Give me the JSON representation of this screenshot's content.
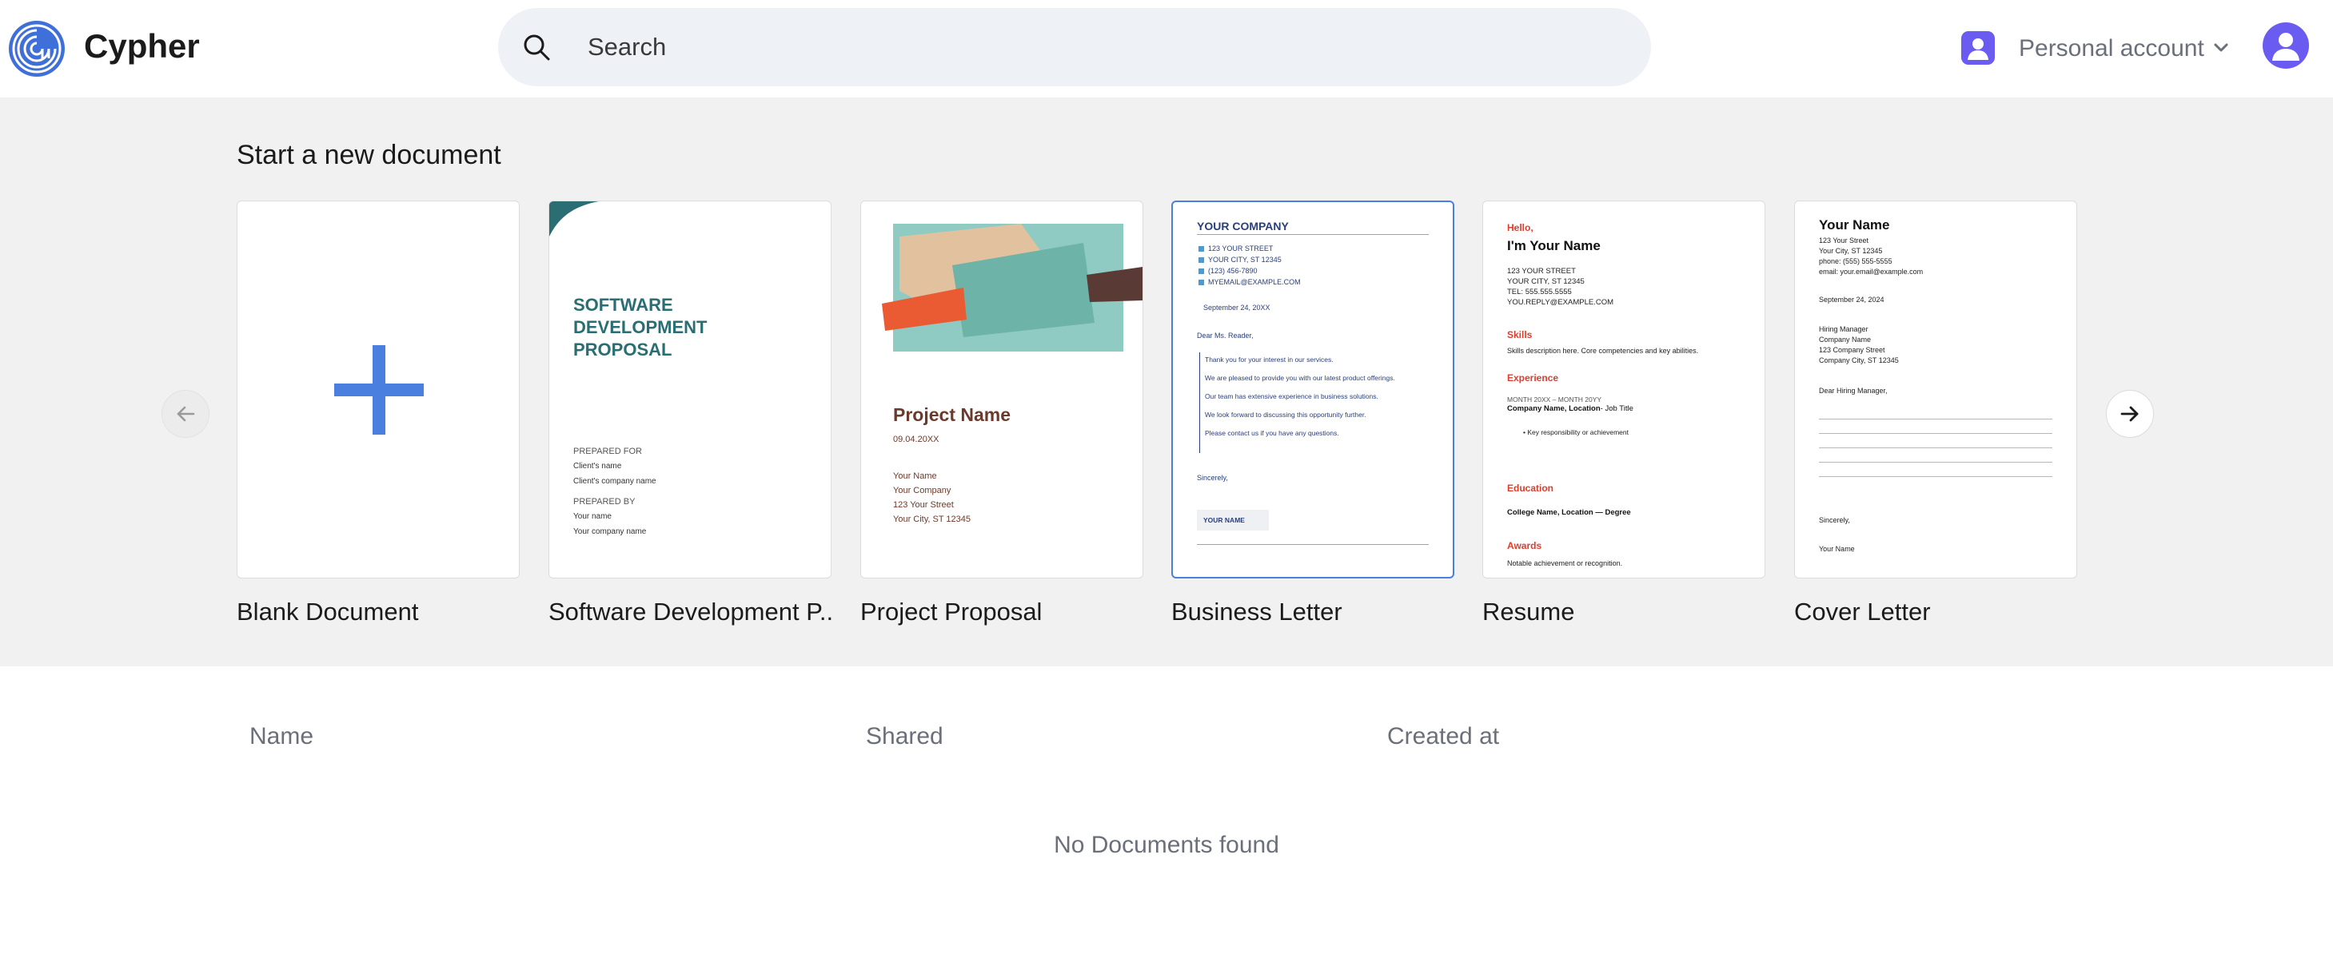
{
  "app": {
    "name": "Cypher"
  },
  "search": {
    "placeholder": "Search"
  },
  "account": {
    "label": "Personal account"
  },
  "templates": {
    "title": "Start a new document",
    "cards": [
      {
        "label": "Blank Document"
      },
      {
        "label": "Software Development P...",
        "preview": {
          "title_lines": [
            "SOFTWARE",
            "DEVELOPMENT",
            "PROPOSAL"
          ],
          "prepared_for": "PREPARED FOR",
          "client_name": "Client's name",
          "client_company": "Client's company name",
          "prepared_by": "PREPARED BY",
          "your_name": "Your name",
          "your_company": "Your company name"
        }
      },
      {
        "label": "Project Proposal",
        "preview": {
          "title": "Project Name",
          "date": "09.04.20XX",
          "lines": [
            "Your Name",
            "Your Company",
            "123 Your Street",
            "Your City, ST 12345"
          ]
        }
      },
      {
        "label": "Business Letter",
        "preview": {
          "company": "YOUR COMPANY",
          "address": [
            "123 YOUR STREET",
            "YOUR CITY, ST 12345",
            "(123) 456-7890",
            "MYEMAIL@EXAMPLE.COM"
          ],
          "date": "September 24, 20XX",
          "greeting": "Dear Ms. Reader,",
          "body": [
            "Thank you for your interest in our services.",
            "We are pleased to provide you with our latest product offerings.",
            "Our team has extensive experience in business solutions.",
            "We look forward to discussing this opportunity further.",
            "Please contact us if you have any questions."
          ],
          "closing": "Sincerely,",
          "signature": "YOUR NAME"
        }
      },
      {
        "label": "Resume",
        "preview": {
          "hello": "Hello,",
          "name": "I'm Your Name",
          "contact": [
            "123 YOUR STREET",
            "YOUR CITY, ST 12345",
            "TEL: 555.555.5555",
            "YOU.REPLY@EXAMPLE.COM"
          ],
          "skills_heading": "Skills",
          "skills_text": "Skills description here. Core competencies and key abilities.",
          "experience_heading": "Experience",
          "experience_dates": "MONTH 20XX – MONTH 20YY",
          "experience_company": "Company Name, Location",
          "experience_title": "- Job Title",
          "experience_bullet": "Key responsibility or achievement",
          "education_heading": "Education",
          "education_text": "College Name, Location — Degree",
          "awards_heading": "Awards",
          "awards_text": "Notable achievement or recognition."
        }
      },
      {
        "label": "Cover Letter",
        "preview": {
          "name": "Your Name",
          "contact": [
            "123 Your Street",
            "Your City, ST 12345",
            "phone: (555) 555-5555",
            "email: your.email@example.com"
          ],
          "date": "September 24, 2024",
          "recipient": [
            "Hiring Manager",
            "Company Name",
            "123 Company Street",
            "Company City, ST 12345"
          ],
          "greeting": "Dear Hiring Manager,",
          "closing": "Sincerely,",
          "signature": "Your Name"
        }
      }
    ]
  },
  "documents": {
    "columns": [
      "Name",
      "Shared",
      "Created at"
    ],
    "empty_message": "No Documents found"
  },
  "colors": {
    "accent": "#4a7fe0",
    "avatar": "#6a5cf0",
    "teal": "#2a6e73",
    "brown": "#6b3a2c",
    "resume_red": "#e03c2c"
  },
  "icons": {
    "logo": "cypher-logo-icon",
    "search": "search-icon",
    "chevron": "chevron-down-icon",
    "prev": "arrow-left-icon",
    "next": "arrow-right-icon",
    "plus": "plus-icon"
  }
}
